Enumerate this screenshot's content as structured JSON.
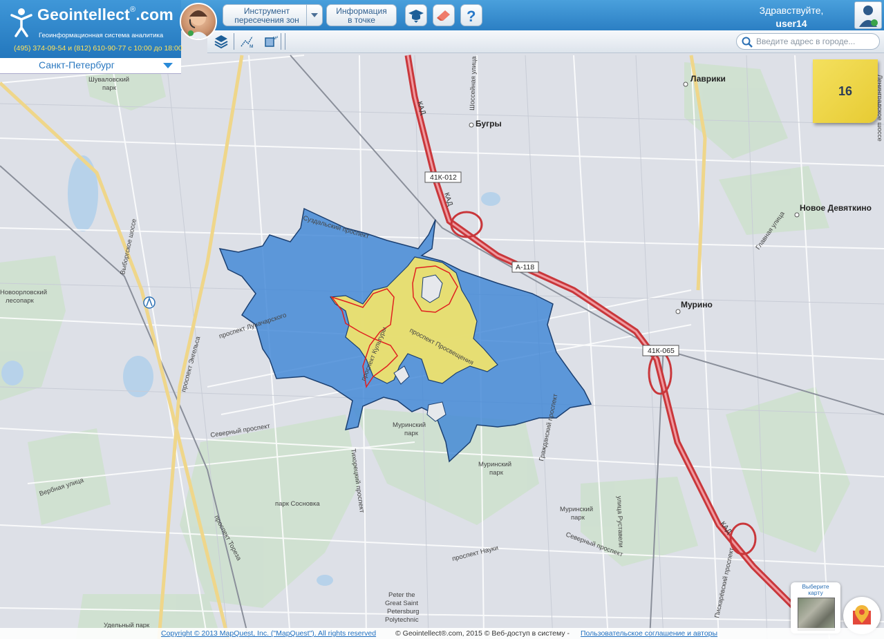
{
  "header": {
    "logo_title": "Geointellect",
    "logo_suffix": ".com",
    "logo_reg": "®",
    "logo_subtitle": "Геоинформационная система аналитика",
    "phone": "(495) 374-09-54 и (812) 610-90-77 с 10:00 до 18:00",
    "city": "Санкт-Петербург",
    "btn_tool_line1": "Инструмент",
    "btn_tool_line2": "пересечения зон",
    "btn_info_line1": "Информация",
    "btn_info_line2": "в точке",
    "icons": [
      "graduation-cap-icon",
      "eraser-icon",
      "help-icon"
    ],
    "greeting": "Здравствуйте,",
    "username": "user14"
  },
  "toolbar": {
    "icons": [
      "layers-icon",
      "measure-distance-icon",
      "measure-area-icon"
    ],
    "search_placeholder": "Введите адрес в городе..."
  },
  "map": {
    "zoom": "16",
    "labels": {
      "lavriki": "Лаврики",
      "bugry": "Бугры",
      "novoe_devyatkino": "Новое Девяткино",
      "murino": "Мурино",
      "kad1": "КАД",
      "kad2": "КАД",
      "kad3": "КАД",
      "shosseynaya": "Шоссейная улица",
      "shuvalovsky": "Шуваловский",
      "shuvalovsky2": "парк",
      "novoorlovsky": "Новоорловский",
      "novoorlovsky2": "лесопарк",
      "vyborgskoe": "Выборгское шоссе",
      "suzdalsky": "Суздальский проспект",
      "engelsa": "проспект Энгельса",
      "lunacharskogo": "проспект Луначарского",
      "kultury": "проспект Культуры",
      "prosvescheniya": "проспект Просвещения",
      "severny": "Северный проспект",
      "murinsky_park1": "Муринский",
      "murinsky_park1b": "парк",
      "murinsky_park2": "Муринский",
      "murinsky_park2b": "парк",
      "murinsky_park3": "Муринский",
      "murinsky_park3b": "парк",
      "tikhoretsky": "Тихорецкий проспект",
      "grazhdansky": "Гражданский проспект",
      "glavnaya": "Главная улица",
      "verbnaya": "Вербная улица",
      "sosnovka": "парк Сосновка",
      "toreza": "проспект Тореза",
      "severny2": "Северный проспект",
      "rustaveli": "улица Руставели",
      "nauki": "проспект Науки",
      "piskarevsky": "Пискарёвский проспект",
      "polytech1": "Peter the",
      "polytech2": "Great Saint",
      "polytech3": "Petersburg",
      "polytech4": "Polytechnic",
      "udelny": "Удельный парк",
      "leningradskoe": "Ленинградское шоссе"
    },
    "shields": [
      "41К-012",
      "А-118",
      "41К-065"
    ],
    "colors": {
      "zone_blue": "#3f86d6",
      "zone_yellow": "#f3e46a",
      "zone_red_outline": "#e02020",
      "kad_road": "#d64a4a",
      "park_green": "#c9dec9"
    }
  },
  "footer": {
    "copyright_link": "Copyright © 2013 MapQuest, Inc. (\"MapQuest\"). All rights reserved",
    "middle": "© Geointellect®.com, 2015 © Веб-доступ в систему - ",
    "terms_link": "Пользовательское соглашение и авторы"
  },
  "map_selector": {
    "label_line1": "Выберите",
    "label_line2": "карту"
  }
}
